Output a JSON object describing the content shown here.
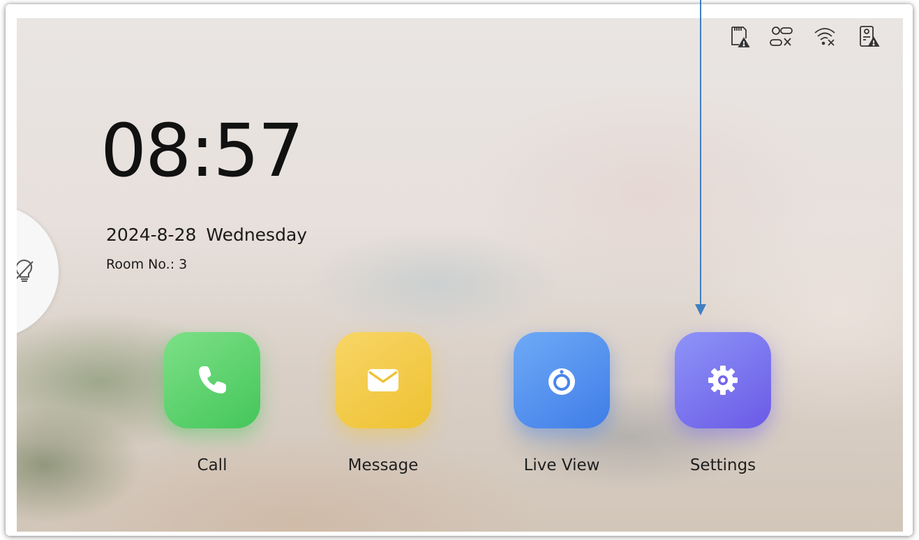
{
  "status_icons": [
    "sd-card-warning-icon",
    "network-disconnected-icon",
    "wifi-off-icon",
    "door-station-warning-icon"
  ],
  "clock": {
    "time": "08:57"
  },
  "date_line": "2024-8-28  Wednesday",
  "room": "Room No.: 3",
  "side_tab": {
    "icon": "lightbulb-off-icon"
  },
  "apps": [
    {
      "label": "Call",
      "icon": "phone-icon",
      "color": "#4cc85e"
    },
    {
      "label": "Message",
      "icon": "envelope-icon",
      "color": "#f0c43a"
    },
    {
      "label": "Live View",
      "icon": "camera-icon",
      "color": "#4a86ec"
    },
    {
      "label": "Settings",
      "icon": "gear-icon",
      "color": "#7463ea"
    }
  ],
  "annotation": {
    "color": "#3f7fc1",
    "target": "Settings"
  }
}
